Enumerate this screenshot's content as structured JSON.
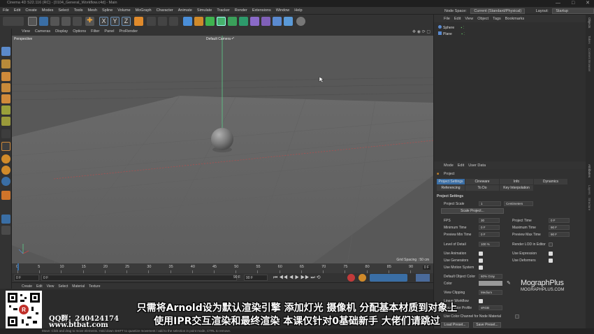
{
  "window": {
    "title": "Cinema 4D S22.116 (RC) - [0104_General_Workflow.c4d] - Main",
    "controls": [
      "—",
      "□",
      "✕"
    ]
  },
  "menubar": {
    "items": [
      "File",
      "Edit",
      "Create",
      "Modes",
      "Select",
      "Tools",
      "Mesh",
      "Spline",
      "Volume",
      "MoGraph",
      "Character",
      "Animate",
      "Simulate",
      "Tracker",
      "Render",
      "Extensions",
      "Window",
      "Help"
    ],
    "node_space_label": "Node Space:",
    "node_space_value": "Current (Standard/Physical)",
    "layout_label": "Layout:",
    "layout_value": "Startup"
  },
  "viewport": {
    "menu": [
      "View",
      "Cameras",
      "Display",
      "Options",
      "Filter",
      "Panel",
      "ProRender"
    ],
    "projection_label": "Perspective",
    "camera_label": "Default Camera •°",
    "grid_spacing": "Grid Spacing : 50 cm"
  },
  "timeline": {
    "ticks": [
      "0",
      "5",
      "10",
      "15",
      "20",
      "25",
      "30",
      "35",
      "40",
      "45",
      "50",
      "55",
      "60",
      "65",
      "70",
      "75",
      "80",
      "85",
      "90"
    ],
    "current_frame": "0 F",
    "start_field": "0 F",
    "start_field2": "0 F",
    "end_field": "90 F",
    "end_field2": "90 F"
  },
  "material_bar": {
    "menu": [
      "Create",
      "Edit",
      "View",
      "Select",
      "Material",
      "Texture"
    ]
  },
  "status_text": "Move: Click and drag to move elements. Hold down SHIFT to quantize movement / add to the selection in point mode, CTRL to remove.",
  "object_manager": {
    "menu": [
      "File",
      "Edit",
      "View",
      "Object",
      "Tags",
      "Bookmarks"
    ],
    "objects": [
      {
        "name": "Sphere"
      },
      {
        "name": "Plane"
      }
    ]
  },
  "attributes": {
    "menu": [
      "Mode",
      "Edit",
      "User Data"
    ],
    "object_label": "Project",
    "tabs_row1": [
      "Project Settings",
      "Cineware",
      "Info",
      "Dynamics"
    ],
    "tabs_row2": [
      "Referencing",
      "To Do",
      "Key Interpolation"
    ],
    "section_title": "Project Settings",
    "project_scale_label": "Project Scale",
    "project_scale_value": "1",
    "project_scale_unit": "Centimeters",
    "scale_project_button": "Scale Project...",
    "fps_label": "FPS",
    "fps_value": "30",
    "project_time_label": "Project Time",
    "project_time_value": "0 F",
    "min_time_label": "Minimum Time",
    "min_time_value": "0 F",
    "max_time_label": "Maximum Time",
    "max_time_value": "90 F",
    "preview_min_label": "Preview Min Time",
    "preview_min_value": "0 F",
    "preview_max_label": "Preview Max Time",
    "preview_max_value": "90 F",
    "lod_label": "Level of Detail",
    "lod_value": "100 %",
    "render_lod_label": "Render LOD in Editor",
    "use_animation_label": "Use Animation",
    "use_expression_label": "Use Expression",
    "use_generators_label": "Use Generators",
    "use_deformers_label": "Use Deformers",
    "use_motion_label": "Use Motion System",
    "default_color_label": "Default Object Color",
    "default_color_value": "60% Gray",
    "color_label": "Color",
    "view_clipping_label": "View Clipping",
    "view_clipping_value": "Medium",
    "linear_workflow_label": "Linear Workflow",
    "input_color_label": "Input Color Profile",
    "input_color_value": "sRGB",
    "node_material_label": "Use Color Channel for Node Material",
    "load_preset_button": "Load Preset...",
    "save_preset_button": "Save Preset..."
  },
  "right_strip": {
    "upper": [
      "Objects",
      "Takes",
      "Content Browser"
    ],
    "lower": [
      "Attributes",
      "Layers",
      "Structure"
    ]
  },
  "overlays": {
    "watermark_brand": "MographPlus",
    "watermark_url": "MOGRAPHPLUS.COM",
    "qq_text": "QQ群：240424174",
    "site_text": "www.btbat.com",
    "subtitle_line1": "只需将Arnold设为默认渲染引擎 添加灯光 摄像机 分配基本材质到对象上",
    "subtitle_line2": "使用IPR交互渲染和最终渲染 本课仅针对0基础新手 大佬们请跳过"
  },
  "colors": {
    "accent_blue": "#3a6ea5",
    "y_axis_green": "#5ccf8a",
    "x_axis_red": "#c24a4a"
  }
}
